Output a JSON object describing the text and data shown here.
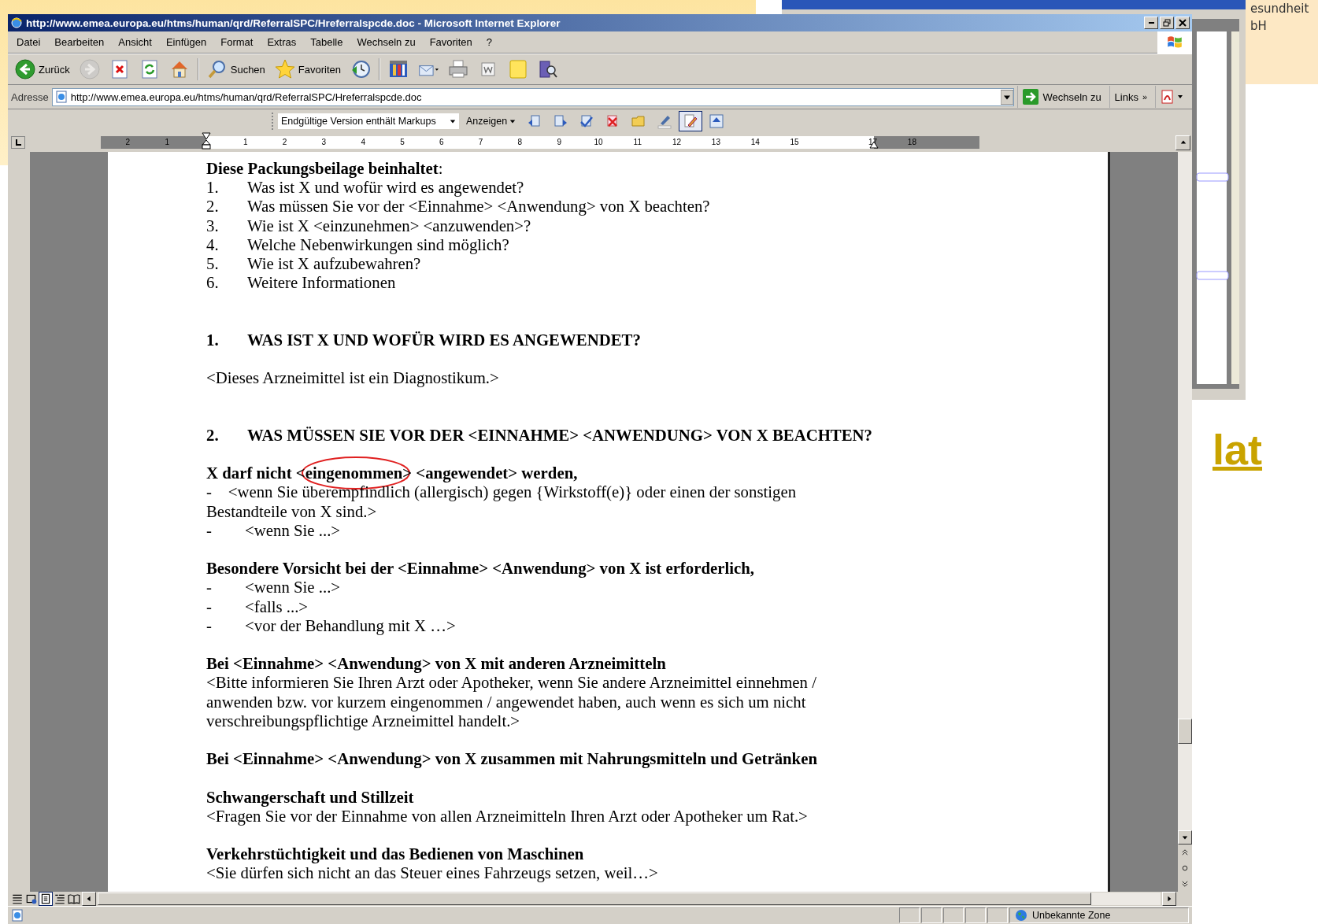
{
  "slide": {
    "right_texts": [
      "esundheit",
      "bH"
    ],
    "link": "lat"
  },
  "window": {
    "title": "http://www.emea.europa.eu/htms/human/qrd/ReferralSPC/Hreferralspcde.doc - Microsoft Internet Explorer"
  },
  "menu": [
    "Datei",
    "Bearbeiten",
    "Ansicht",
    "Einfügen",
    "Format",
    "Extras",
    "Tabelle",
    "Wechseln zu",
    "Favoriten",
    "?"
  ],
  "toolbar": [
    {
      "kind": "back",
      "label": "Zurück",
      "disabled": false
    },
    {
      "kind": "forward",
      "disabled": true
    },
    {
      "kind": "stop",
      "disabled": false
    },
    {
      "kind": "refresh",
      "disabled": false
    },
    {
      "kind": "home",
      "disabled": false
    },
    {
      "kind": "separator"
    },
    {
      "kind": "search",
      "label": "Suchen",
      "disabled": false
    },
    {
      "kind": "favorites",
      "label": "Favoriten",
      "disabled": false
    },
    {
      "kind": "history",
      "disabled": false
    },
    {
      "kind": "separator"
    },
    {
      "kind": "research",
      "disabled": false
    },
    {
      "kind": "mail",
      "disabled": false
    },
    {
      "kind": "print",
      "disabled": false
    },
    {
      "kind": "word",
      "disabled": false
    },
    {
      "kind": "note",
      "disabled": false
    },
    {
      "kind": "messenger",
      "disabled": false
    }
  ],
  "address": {
    "label": "Adresse",
    "value": "http://www.emea.europa.eu/htms/human/qrd/ReferralSPC/Hreferralspcde.doc",
    "go": "Wechseln zu",
    "links": "Links",
    "more": "»"
  },
  "review_toolbar": {
    "display": "Endgültige Version enthält Markups",
    "show": "Anzeigen",
    "tools": [
      {
        "kind": "previous",
        "on": false
      },
      {
        "kind": "next",
        "on": false
      },
      {
        "kind": "accept",
        "on": false
      },
      {
        "kind": "reject",
        "on": false
      },
      {
        "kind": "comment",
        "on": false
      },
      {
        "kind": "highlight",
        "on": false
      },
      {
        "kind": "track",
        "on": true
      },
      {
        "kind": "pane",
        "on": false
      }
    ]
  },
  "ruler": [
    "2",
    "1",
    "1",
    "2",
    "3",
    "4",
    "5",
    "6",
    "7",
    "8",
    "9",
    "10",
    "11",
    "12",
    "13",
    "14",
    "15",
    "17",
    "18"
  ],
  "document": [
    {
      "kind": "lead",
      "text": "**Diese Packungsbeilage beinhaltet**:"
    },
    {
      "kind": "numbered",
      "number": "1.",
      "text": "Was ist X und wofür wird es angewendet?"
    },
    {
      "kind": "numbered",
      "number": "2.",
      "text": "Was müssen Sie vor der <Einnahme> <Anwendung> von X beachten?"
    },
    {
      "kind": "numbered",
      "number": "3.",
      "text": "Wie ist X <einzunehmen> <anzuwenden>?"
    },
    {
      "kind": "numbered",
      "number": "4.",
      "text": "Welche Nebenwirkungen sind möglich?"
    },
    {
      "kind": "numbered",
      "number": "5.",
      "text": "Wie ist X aufzubewahren?"
    },
    {
      "kind": "numbered",
      "number": "6.",
      "text": "Weitere Informationen"
    },
    {
      "kind": "section",
      "number": "1.",
      "text": "WAS IST X UND WOFÜR WIRD ES ANGEWENDET?"
    },
    {
      "kind": "note",
      "text": "<Dieses Arzneimittel ist ein Diagnostikum.>"
    },
    {
      "kind": "section",
      "number": "2.",
      "text": "WAS MÜSSEN SIE VOR DER <EINNAHME> <ANWENDUNG> VON X BEACHTEN?"
    },
    {
      "kind": "subheading",
      "text": "X darf nicht <eingenommen> <angewendet> werden,",
      "circled": true
    },
    {
      "kind": "dash_wrap",
      "text": "-    <wenn Sie überempfindlich (allergisch) gegen {Wirkstoff(e)} oder einen der sonstigen Bestandteile von X sind.>"
    },
    {
      "kind": "dash",
      "text": "-\t<wenn Sie ...>"
    },
    {
      "kind": "subheading",
      "text": "Besondere Vorsicht bei der <Einnahme> <Anwendung> von X ist erforderlich,"
    },
    {
      "kind": "dash",
      "text": "-\t<wenn Sie ...>"
    },
    {
      "kind": "dash",
      "text": "-\t<falls ...>"
    },
    {
      "kind": "dash",
      "text": "-\t<vor der Behandlung mit X …>"
    },
    {
      "kind": "subheading",
      "text": "Bei <Einnahme> <Anwendung> von X mit anderen Arzneimitteln"
    },
    {
      "kind": "body",
      "text": "<Bitte informieren Sie Ihren Arzt oder Apotheker, wenn Sie andere Arzneimittel einnehmen / anwenden bzw. vor kurzem eingenommen / angewendet haben, auch wenn es sich um nicht verschreibungspflichtige Arzneimittel handelt.>"
    },
    {
      "kind": "subheading",
      "text": "Bei <Einnahme> <Anwendung> von X zusammen mit Nahrungsmitteln und Getränken"
    },
    {
      "kind": "subheading",
      "text": "Schwangerschaft und Stillzeit"
    },
    {
      "kind": "body",
      "text": "<Fragen Sie vor der Einnahme von allen Arzneimitteln Ihren Arzt oder Apotheker um Rat.>"
    },
    {
      "kind": "subheading",
      "text": "Verkehrstüchtigkeit und das Bedienen von Maschinen"
    },
    {
      "kind": "body",
      "text": "<Sie dürfen sich nicht an das Steuer eines Fahrzeugs setzen, weil…>"
    }
  ],
  "status_bar": {
    "zone": "Unbekannte Zone"
  }
}
